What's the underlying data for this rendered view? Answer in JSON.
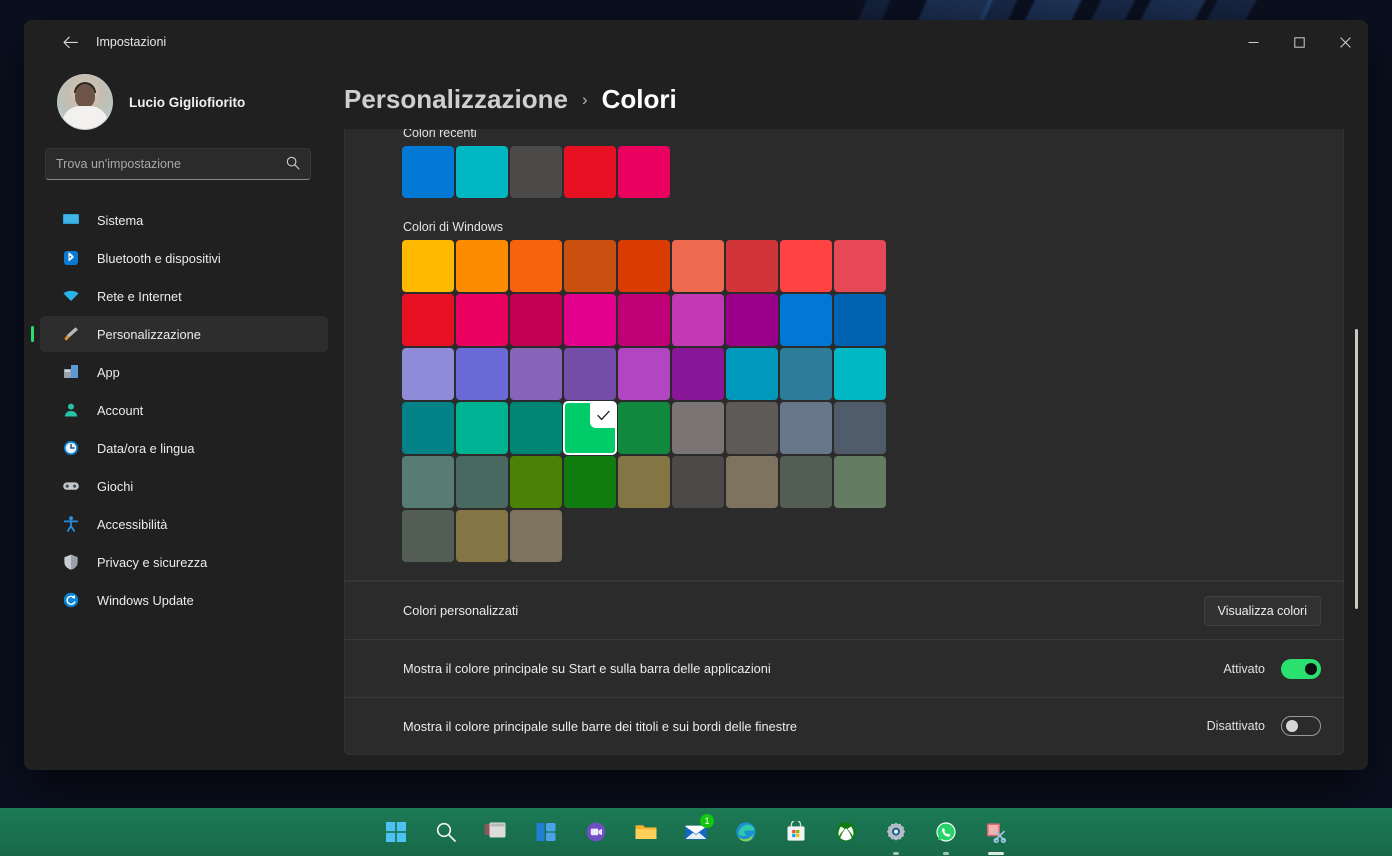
{
  "window": {
    "app_title": "Impostazioni",
    "back_icon": "arrow-left-icon",
    "minimize_label": "—",
    "maximize_label": "☐",
    "close_label": "✕"
  },
  "sidebar": {
    "profile": {
      "name": "Lucio Gigliofiorito"
    },
    "search": {
      "placeholder": "Trova un'impostazione",
      "value": "",
      "icon": "search-icon"
    },
    "items": [
      {
        "label": "Sistema",
        "icon": "monitor-icon",
        "selected": false
      },
      {
        "label": "Bluetooth e dispositivi",
        "icon": "bluetooth-icon",
        "selected": false
      },
      {
        "label": "Rete e Internet",
        "icon": "wifi-icon",
        "selected": false
      },
      {
        "label": "Personalizzazione",
        "icon": "paintbrush-icon",
        "selected": true
      },
      {
        "label": "App",
        "icon": "apps-icon",
        "selected": false
      },
      {
        "label": "Account",
        "icon": "person-icon",
        "selected": false
      },
      {
        "label": "Data/ora e lingua",
        "icon": "clock-icon",
        "selected": false
      },
      {
        "label": "Giochi",
        "icon": "gamepad-icon",
        "selected": false
      },
      {
        "label": "Accessibilità",
        "icon": "accessibility-icon",
        "selected": false
      },
      {
        "label": "Privacy e sicurezza",
        "icon": "shield-icon",
        "selected": false
      },
      {
        "label": "Windows Update",
        "icon": "update-icon",
        "selected": false
      }
    ]
  },
  "breadcrumb": {
    "parent": "Personalizzazione",
    "separator": "›",
    "current": "Colori"
  },
  "colors_page": {
    "recent_label": "Colori recenti",
    "recent_colors": [
      "#0078D4",
      "#00B7C3",
      "#4C4A48",
      "#E81123",
      "#EA005E"
    ],
    "windows_label": "Colori di Windows",
    "windows_colors": [
      "#FFB900",
      "#FF8C00",
      "#F7630C",
      "#CA5010",
      "#DA3B01",
      "#EF6950",
      "#D13438",
      "#FF4343",
      "#E74856",
      "#E81123",
      "#EA005E",
      "#C30052",
      "#E3008C",
      "#BF0077",
      "#C239B3",
      "#9A0089",
      "#0078D4",
      "#0063B1",
      "#8E8CD8",
      "#6B69D6",
      "#8764B8",
      "#744DA9",
      "#B146C2",
      "#881798",
      "#0099BC",
      "#2D7D9A",
      "#00B7C3",
      "#038387",
      "#00B294",
      "#018574",
      "#00CC6A",
      "#10893E",
      "#7A7574",
      "#5D5A58",
      "#68768A",
      "#515C6B",
      "#567C73",
      "#486860",
      "#498205",
      "#107C10",
      "#847545",
      "#4C4A48",
      "#7E735F",
      "#525E54",
      "#647C64",
      "#525E54",
      "#847545",
      "#7E735F"
    ],
    "selected_index": 30,
    "selected_color": "#00CC6A",
    "check_icon": "checkmark-icon",
    "rows": [
      {
        "label": "Colori personalizzati",
        "control": "button",
        "button_label": "Visualizza colori"
      },
      {
        "label": "Mostra il colore principale su Start e sulla barra delle applicazioni",
        "control": "toggle",
        "state_label": "Attivato",
        "state": "on"
      },
      {
        "label": "Mostra il colore principale sulle barre dei titoli e sui bordi delle finestre",
        "control": "toggle",
        "state_label": "Disattivato",
        "state": "off"
      }
    ]
  },
  "taskbar": {
    "items": [
      {
        "name": "start-icon",
        "badge": "",
        "active": false,
        "running": false
      },
      {
        "name": "search-icon",
        "badge": "",
        "active": false,
        "running": false
      },
      {
        "name": "task-view-icon",
        "badge": "",
        "active": false,
        "running": false
      },
      {
        "name": "widgets-icon",
        "badge": "",
        "active": false,
        "running": false
      },
      {
        "name": "chat-teams-icon",
        "badge": "",
        "active": false,
        "running": false
      },
      {
        "name": "file-explorer-icon",
        "badge": "",
        "active": false,
        "running": false
      },
      {
        "name": "mail-icon",
        "badge": "1",
        "active": false,
        "running": false
      },
      {
        "name": "edge-icon",
        "badge": "",
        "active": false,
        "running": false
      },
      {
        "name": "microsoft-store-icon",
        "badge": "",
        "active": false,
        "running": false
      },
      {
        "name": "xbox-icon",
        "badge": "",
        "active": false,
        "running": false
      },
      {
        "name": "settings-icon",
        "badge": "",
        "active": false,
        "running": true
      },
      {
        "name": "whatsapp-icon",
        "badge": "",
        "active": false,
        "running": true
      },
      {
        "name": "snipping-tool-icon",
        "badge": "",
        "active": true,
        "running": false
      }
    ]
  },
  "theme": {
    "accent": "#2ae06f",
    "window_bg": "#202020",
    "card_bg": "#2b2b2b",
    "taskbar_bg": "#1d7a55"
  }
}
